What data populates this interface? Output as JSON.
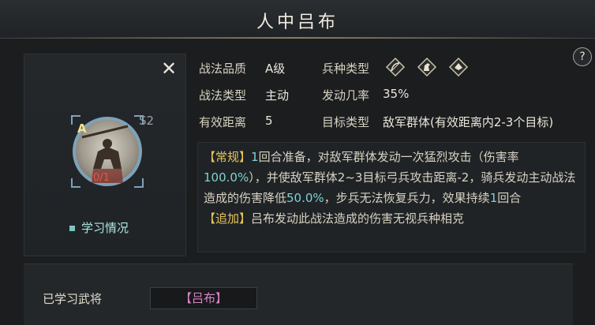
{
  "title": "人中吕布",
  "help_label": "?",
  "close_label": "✕",
  "skill": {
    "grade_badge": "A",
    "stage": "S2",
    "progress": "0/1",
    "learn_status": "学习情况"
  },
  "info": {
    "quality_label": "战法品质",
    "quality_value": "A级",
    "type_label": "战法类型",
    "type_value": "主动",
    "range_label": "有效距离",
    "range_value": "5",
    "troop_label": "兵种类型",
    "rate_label": "发动几率",
    "rate_value": "35%",
    "target_label": "目标类型",
    "target_value": "敌军群体(有效距离内2-3个目标)"
  },
  "troop_icons": [
    "archer-icon",
    "cavalry-icon",
    "infantry-icon"
  ],
  "description": {
    "normal_tag": "【常规】",
    "p1": "1",
    "p2": "回合准备，对敌军群体发动一次猛烈攻击（伤害率",
    "p3": "100.0%",
    "p4": "），并使敌军群体2~3目标弓兵攻击距离-2，骑兵发动主动战法造成的伤害降低",
    "p5": "50.0%",
    "p6": "，步兵无法恢复兵力，效果持续",
    "p7": "1",
    "p8": "回合",
    "extra_tag": "【追加】",
    "extra_text": "吕布发动此战法造成的伤害无视兵种相克"
  },
  "learned": {
    "label": "已学习武将",
    "general": "【吕布】"
  },
  "colors": {
    "highlight": "#7ed3cf",
    "tag": "#e8c55a",
    "general": "#d884c6",
    "frame": "#7ea2b8"
  }
}
